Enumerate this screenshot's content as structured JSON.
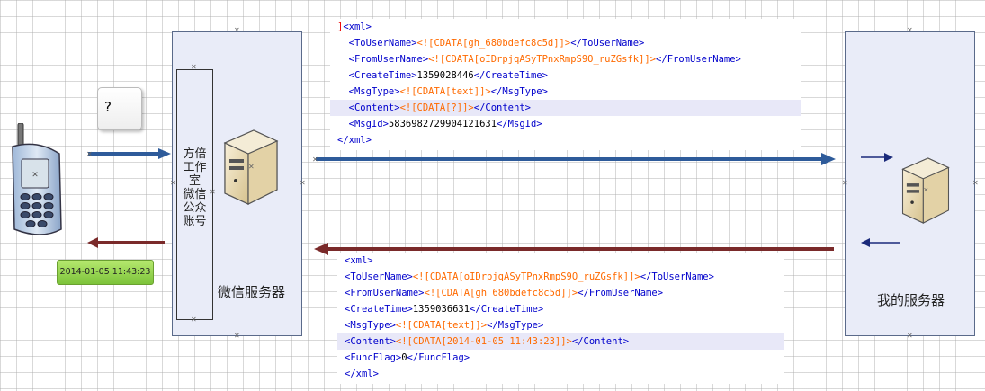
{
  "phone": {
    "icon": "mobile-phone-icon"
  },
  "user_message": {
    "text": "?"
  },
  "reply_timestamp": {
    "text": "2014-01-05 11:43:23"
  },
  "wechat_server": {
    "label": "微信服务器",
    "account_label": "方倍工作室微信公众账号",
    "account_lines": [
      "方倍",
      "工作",
      "室",
      "微信",
      "公众",
      "账号"
    ],
    "icon": "server-icon"
  },
  "my_server": {
    "label": "我的服务器",
    "icon": "server-icon"
  },
  "request_xml": [
    {
      "prefix": "",
      "mark": "]",
      "open": "<xml>",
      "cdata": "",
      "value": "",
      "close": "",
      "hl": false
    },
    {
      "prefix": "  ",
      "mark": "",
      "open": "<ToUserName>",
      "cdata": "<![CDATA[gh_680bdefc8c5d]]>",
      "value": "",
      "close": "</ToUserName>",
      "hl": false
    },
    {
      "prefix": "  ",
      "mark": "",
      "open": "<FromUserName>",
      "cdata": "<![CDATA[oIDrpjqASyTPnxRmpS9O_ruZGsfk]]>",
      "value": "",
      "close": "</FromUserName>",
      "hl": false
    },
    {
      "prefix": "  ",
      "mark": "",
      "open": "<CreateTime>",
      "cdata": "",
      "value": "1359028446",
      "close": "</CreateTime>",
      "hl": false
    },
    {
      "prefix": "  ",
      "mark": "",
      "open": "<MsgType>",
      "cdata": "<![CDATA[text]]>",
      "value": "",
      "close": "</MsgType>",
      "hl": false
    },
    {
      "prefix": "  ",
      "mark": "",
      "open": "<Content>",
      "cdata": "<![CDATA[?]]>",
      "value": "",
      "close": "</Content>",
      "hl": true
    },
    {
      "prefix": "  ",
      "mark": "",
      "open": "<MsgId>",
      "cdata": "",
      "value": "5836982729904121631",
      "close": "</MsgId>",
      "hl": false
    },
    {
      "prefix": "",
      "mark": "",
      "open": "</xml>",
      "cdata": "",
      "value": "",
      "close": "",
      "hl": false
    }
  ],
  "response_xml": [
    {
      "prefix": "",
      "mark": "",
      "open": "<xml>",
      "cdata": "",
      "value": "",
      "close": "",
      "hl": false
    },
    {
      "prefix": "",
      "mark": "",
      "open": "<ToUserName>",
      "cdata": "<![CDATA[oIDrpjqASyTPnxRmpS9O_ruZGsfk]]>",
      "value": "",
      "close": "</ToUserName>",
      "hl": false
    },
    {
      "prefix": "",
      "mark": "",
      "open": "<FromUserName>",
      "cdata": "<![CDATA[gh_680bdefc8c5d]]>",
      "value": "",
      "close": "</FromUserName>",
      "hl": false
    },
    {
      "prefix": "",
      "mark": "",
      "open": "<CreateTime>",
      "cdata": "",
      "value": "1359036631",
      "close": "</CreateTime>",
      "hl": false
    },
    {
      "prefix": "",
      "mark": "",
      "open": "<MsgType>",
      "cdata": "<![CDATA[text]]>",
      "value": "",
      "close": "</MsgType>",
      "hl": false
    },
    {
      "prefix": "",
      "mark": "",
      "open": "<Content>",
      "cdata": "<![CDATA[2014-01-05 11:43:23]]>",
      "value": "",
      "close": "</Content>",
      "hl": true
    },
    {
      "prefix": "",
      "mark": "",
      "open": "<FuncFlag>",
      "cdata": "",
      "value": "0",
      "close": "</FuncFlag>",
      "hl": false
    },
    {
      "prefix": "",
      "mark": "",
      "open": "</xml>",
      "cdata": "",
      "value": "",
      "close": "",
      "hl": false
    }
  ],
  "colors": {
    "request_arrow": "#2e5b9a",
    "response_arrow": "#7a2a2a",
    "navy_arrow": "#1a2a7a",
    "panel_fill": "#e9ecf8",
    "panel_border": "#5a6a8a"
  }
}
